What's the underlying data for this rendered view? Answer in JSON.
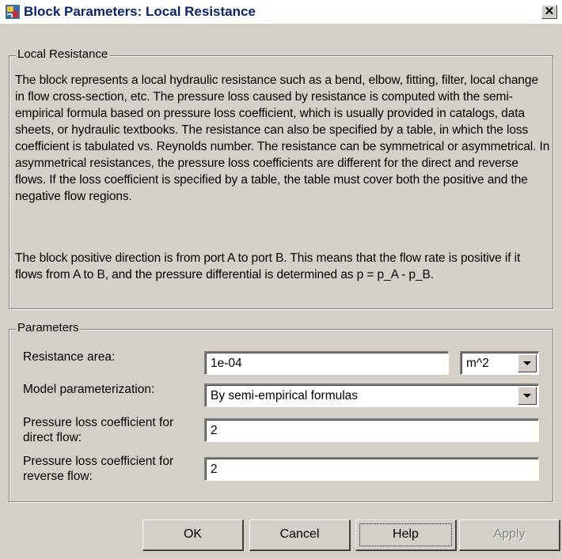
{
  "window": {
    "title": "Block Parameters: Local Resistance",
    "close_glyph": "✕",
    "icon": "simulink-block-icon"
  },
  "description_group": {
    "label": "Local Resistance",
    "paragraph1": "The block represents a local hydraulic resistance such as a bend, elbow, fitting, filter, local change in flow cross-section, etc. The pressure loss caused by resistance is computed with the semi-empirical formula based on pressure loss coefficient, which is usually provided in catalogs, data sheets, or hydraulic textbooks. The resistance can also be specified by a table, in which the loss coefficient is tabulated vs. Reynolds number. The resistance can be symmetrical or asymmetrical. In asymmetrical resistances, the pressure loss coefficients are different for the direct and reverse flows. If the loss coefficient is specified by a table, the table must cover both the positive and the negative flow regions.",
    "paragraph2": "The block positive direction is from port A to port B. This means that the flow rate is positive if it flows from A to B, and the pressure differential is determined as p = p_A - p_B."
  },
  "parameters_group": {
    "label": "Parameters",
    "resistance_area": {
      "label": "Resistance area:",
      "value": "1e-04",
      "unit": "m^2"
    },
    "model_parameterization": {
      "label": "Model parameterization:",
      "value": "By semi-empirical formulas"
    },
    "direct_flow": {
      "label_line1": "Pressure loss coefficient for",
      "label_line2": "direct flow:",
      "value": "2"
    },
    "reverse_flow": {
      "label_line1": "Pressure loss coefficient for",
      "label_line2": "reverse flow:",
      "value": "2"
    }
  },
  "buttons": {
    "ok": "OK",
    "cancel": "Cancel",
    "help": "Help",
    "apply": "Apply"
  }
}
